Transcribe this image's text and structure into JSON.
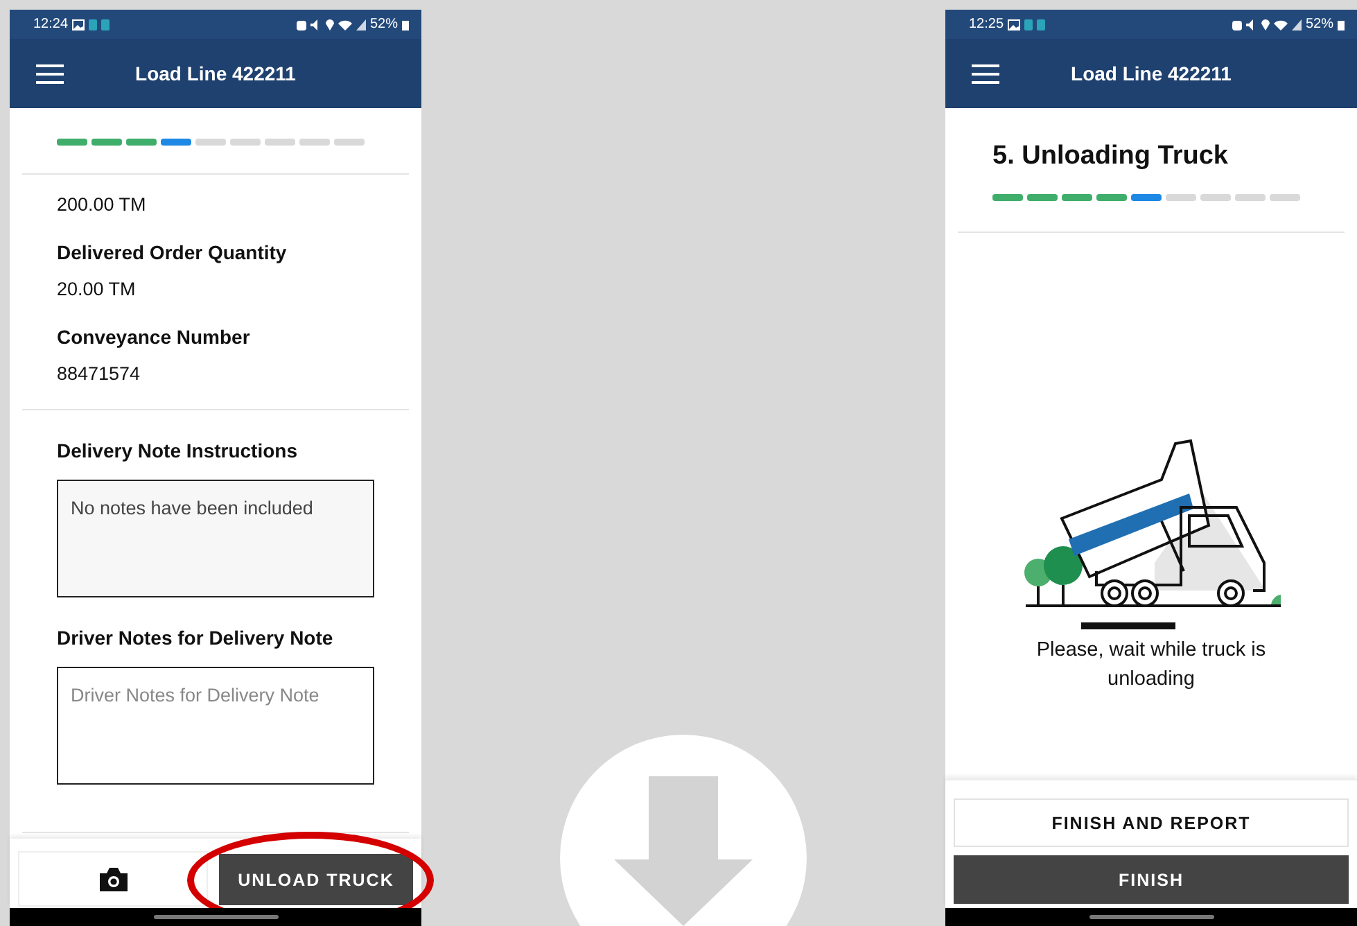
{
  "screens": [
    {
      "kind": "delivery_notes",
      "status_bar": {
        "time": "12:24",
        "battery": "52%"
      },
      "app_bar": {
        "title": "Load Line 422211"
      },
      "steps": [
        {
          "completed": true,
          "current": false
        },
        {
          "completed": true,
          "current": false
        },
        {
          "completed": true,
          "current": false
        },
        {
          "completed": false,
          "current": true
        },
        {
          "completed": false,
          "current": false
        },
        {
          "completed": false,
          "current": false
        },
        {
          "completed": false,
          "current": false
        },
        {
          "completed": false,
          "current": false
        },
        {
          "completed": false,
          "current": false
        }
      ],
      "fields": [
        {
          "value": "200.00 TM"
        },
        {
          "label": "Delivered Order Quantity",
          "value": "20.00 TM"
        },
        {
          "label": "Conveyance Number",
          "value": "88471574"
        }
      ],
      "notes": [
        {
          "label": "Delivery Note Instructions",
          "value": "No notes have been included"
        },
        {
          "label": "Driver Notes for Delivery Note",
          "placeholder": "Driver Notes for Delivery Note"
        }
      ],
      "actions": [
        {
          "kind": "camera"
        },
        {
          "kind": "primary",
          "label": "UNLOAD TRUCK",
          "highlighted": true
        }
      ]
    },
    {
      "kind": "unloading",
      "status_bar": {
        "time": "12:25",
        "battery": "52%"
      },
      "app_bar": {
        "title": "Load Line 422211"
      },
      "heading": "5. Unloading Truck",
      "steps": [
        {
          "completed": true,
          "current": false
        },
        {
          "completed": true,
          "current": false
        },
        {
          "completed": true,
          "current": false
        },
        {
          "completed": true,
          "current": false
        },
        {
          "completed": false,
          "current": true
        },
        {
          "completed": false,
          "current": false
        },
        {
          "completed": false,
          "current": false
        },
        {
          "completed": false,
          "current": false
        },
        {
          "completed": false,
          "current": false
        }
      ],
      "message": "Please, wait while truck is unloading",
      "actions": [
        {
          "kind": "secondary",
          "label": "FINISH AND REPORT",
          "highlighted": false
        },
        {
          "kind": "primary",
          "label": "FINISH",
          "highlighted": false
        }
      ]
    }
  ]
}
